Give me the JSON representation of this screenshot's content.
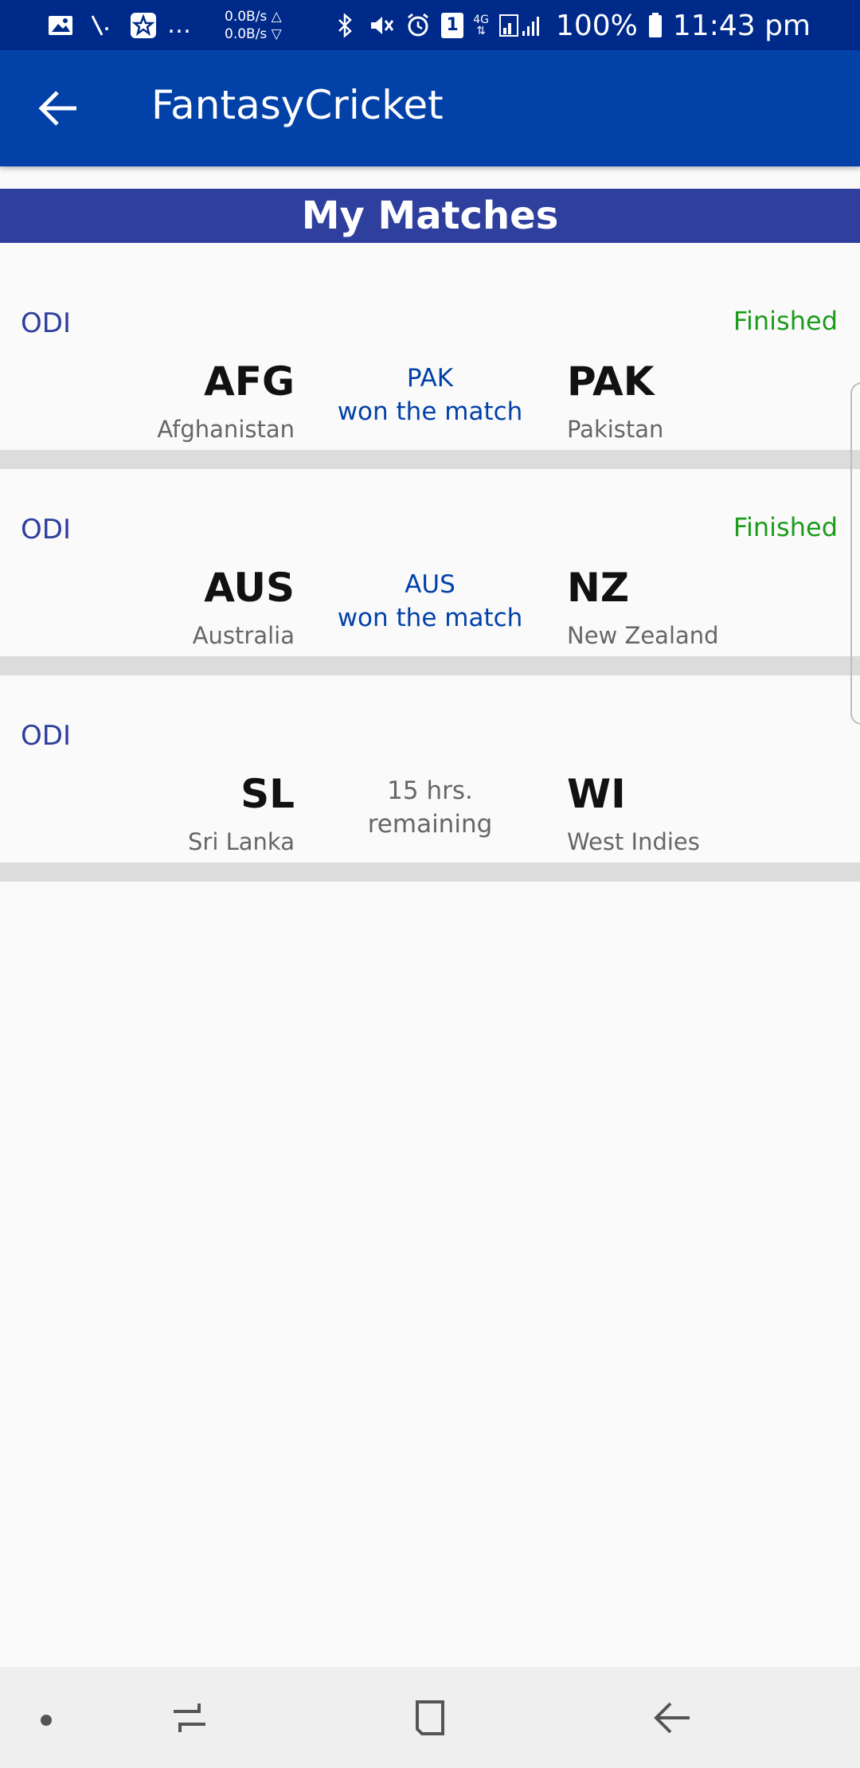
{
  "status_bar": {
    "net_up": "0.0B/s △",
    "net_down": "0.0B/s ▽",
    "battery": "100%",
    "time": "11:43 pm",
    "notif_count": "1",
    "network_type": "4G",
    "icons": [
      "image-icon",
      "call-missed-icon",
      "star-app-icon",
      "bluetooth-icon",
      "mute-icon",
      "alarm-icon",
      "signal-icon",
      "battery-icon"
    ]
  },
  "app_bar": {
    "title": "FantasyCricket",
    "back_icon": "arrow-left-icon"
  },
  "section": {
    "title": "My Matches"
  },
  "matches": [
    {
      "format": "ODI",
      "status": "Finished",
      "team1_code": "AFG",
      "team1_name": "Afghanistan",
      "team2_code": "PAK",
      "team2_name": "Pakistan",
      "result_line1": "PAK",
      "result_line2": "won the match"
    },
    {
      "format": "ODI",
      "status": "Finished",
      "team1_code": "AUS",
      "team1_name": "Australia",
      "team2_code": "NZ",
      "team2_name": "New Zealand",
      "result_line1": "AUS",
      "result_line2": "won the match"
    },
    {
      "format": "ODI",
      "status": "",
      "team1_code": "SL",
      "team1_name": "Sri Lanka",
      "team2_code": "WI",
      "team2_name": "West Indies",
      "result_line1": "15 hrs.",
      "result_line2": "remaining"
    }
  ],
  "colors": {
    "status_bar": "#002a8a",
    "app_bar": "#0241a8",
    "section_header": "#2f3f9d",
    "finished": "#1a9c1a",
    "result_text": "#0241a8"
  },
  "nav_bar": {
    "icons": [
      "nav-dot-icon",
      "recents-icon",
      "home-icon",
      "back-icon"
    ]
  }
}
